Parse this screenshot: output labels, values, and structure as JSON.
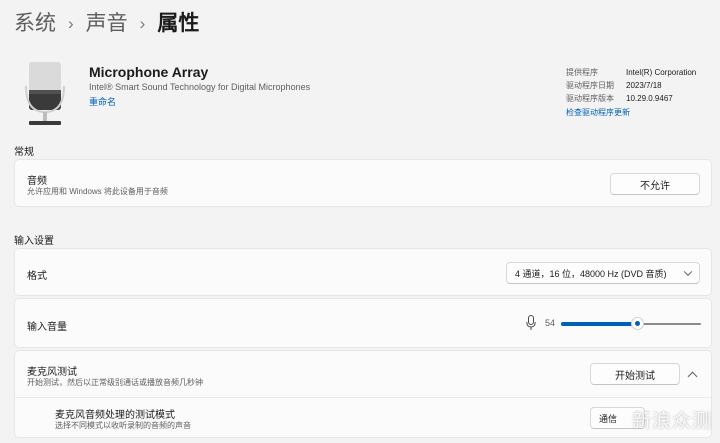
{
  "breadcrumb": {
    "items": [
      "系统",
      "声音",
      "属性"
    ]
  },
  "device": {
    "name": "Microphone Array",
    "description": "Intel® Smart Sound Technology for Digital Microphones",
    "rename_link": "重命名",
    "icon": "microphone-icon"
  },
  "driver": {
    "rows": [
      {
        "label": "提供程序",
        "value": "Intel(R) Corporation"
      },
      {
        "label": "驱动程序日期",
        "value": "2023/7/18"
      },
      {
        "label": "驱动程序版本",
        "value": "10.29.0.9467"
      }
    ],
    "update_link": "检查驱动程序更新"
  },
  "general": {
    "title": "常规",
    "audio": {
      "title": "音频",
      "subtitle": "允许应用和 Windows 将此设备用于音频",
      "button": "不允许"
    }
  },
  "input_settings": {
    "title": "输入设置",
    "format": {
      "label": "格式",
      "value": "4 通道，16 位，48000 Hz (DVD 音质)"
    },
    "volume": {
      "label": "输入音量",
      "value": "54",
      "level": 0.54
    },
    "mic_test": {
      "title": "麦克风测试",
      "subtitle": "开始测试，然后以正常级别通话或播放音频几秒钟",
      "button": "开始测试"
    },
    "test_mode": {
      "title": "麦克风音频处理的测试模式",
      "subtitle": "选择不同模式以收听录制的音频的声音",
      "value": "通信"
    }
  },
  "watermark": "新浪众测",
  "colors": {
    "accent": "#005fb8",
    "background": "#f3f3f3",
    "card": "#fbfbfb"
  }
}
